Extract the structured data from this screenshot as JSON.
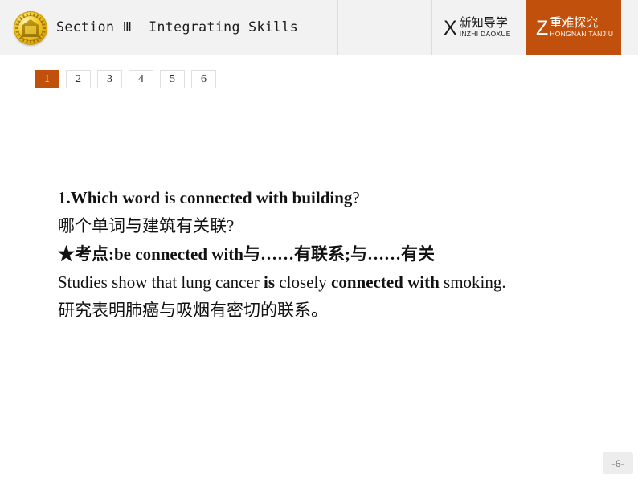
{
  "header": {
    "emblem_icon": "gold-medal-emblem-icon",
    "title": "Section Ⅲ  Integrating Skills",
    "badges": [
      {
        "letter": "X",
        "cn": "新知导学",
        "pinyin": "INZHI DAOXUE",
        "style": "light"
      },
      {
        "letter": "Z",
        "cn": "重难探究",
        "pinyin": "HONGNAN TANJIU",
        "style": "orange"
      }
    ],
    "accent_color": "#c1500d",
    "background_color": "#f2f2f2"
  },
  "tabs": {
    "items": [
      "1",
      "2",
      "3",
      "4",
      "5",
      "6"
    ],
    "active_index": 0
  },
  "content": {
    "lines": [
      {
        "id": "q-en",
        "text": "1.Which word is connected with building?",
        "weight": "bold-with-normal-qmark"
      },
      {
        "id": "q-cn",
        "text": "哪个单词与建筑有关联?",
        "weight": "normal"
      },
      {
        "id": "point",
        "text": "★考点:be connected with与……有联系;与……有关",
        "weight": "bold"
      },
      {
        "id": "example-en",
        "text": "Studies show that lung cancer is closely connected with smoking.",
        "weight": "mixed"
      },
      {
        "id": "example-cn",
        "text": "研究表明肺癌与吸烟有密切的联系。",
        "weight": "normal"
      }
    ],
    "q_en_bold_part": "1.Which word is connected with building",
    "q_en_tail": "?",
    "example_seg1": "Studies show that lung cancer ",
    "example_seg2": "is",
    "example_seg3": " closely ",
    "example_seg4": "connected with",
    "example_seg5": " smoking."
  },
  "footer": {
    "page_label": "-6-"
  }
}
